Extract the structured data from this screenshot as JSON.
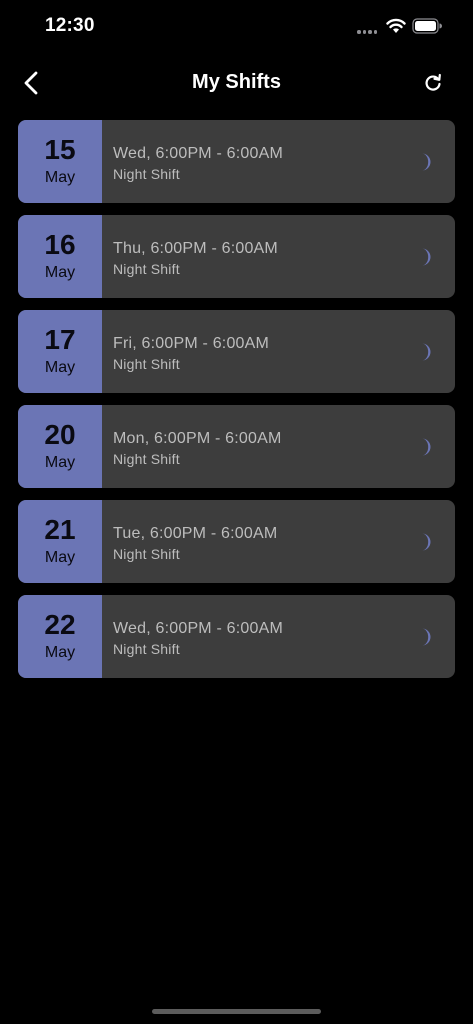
{
  "status_bar": {
    "time": "12:30"
  },
  "header": {
    "title": "My Shifts",
    "back_icon": "chevron-left-icon",
    "refresh_icon": "refresh-icon"
  },
  "colors": {
    "accent": "#6b75b5",
    "card_bg": "#3d3d3d",
    "background": "#000000"
  },
  "shifts": [
    {
      "day": "15",
      "month": "May",
      "time": "Wed, 6:00PM - 6:00AM",
      "type": "Night Shift",
      "icon": "moon-icon"
    },
    {
      "day": "16",
      "month": "May",
      "time": "Thu, 6:00PM - 6:00AM",
      "type": "Night Shift",
      "icon": "moon-icon"
    },
    {
      "day": "17",
      "month": "May",
      "time": "Fri, 6:00PM - 6:00AM",
      "type": "Night Shift",
      "icon": "moon-icon"
    },
    {
      "day": "20",
      "month": "May",
      "time": "Mon, 6:00PM - 6:00AM",
      "type": "Night Shift",
      "icon": "moon-icon"
    },
    {
      "day": "21",
      "month": "May",
      "time": "Tue, 6:00PM - 6:00AM",
      "type": "Night Shift",
      "icon": "moon-icon"
    },
    {
      "day": "22",
      "month": "May",
      "time": "Wed, 6:00PM - 6:00AM",
      "type": "Night Shift",
      "icon": "moon-icon"
    }
  ]
}
